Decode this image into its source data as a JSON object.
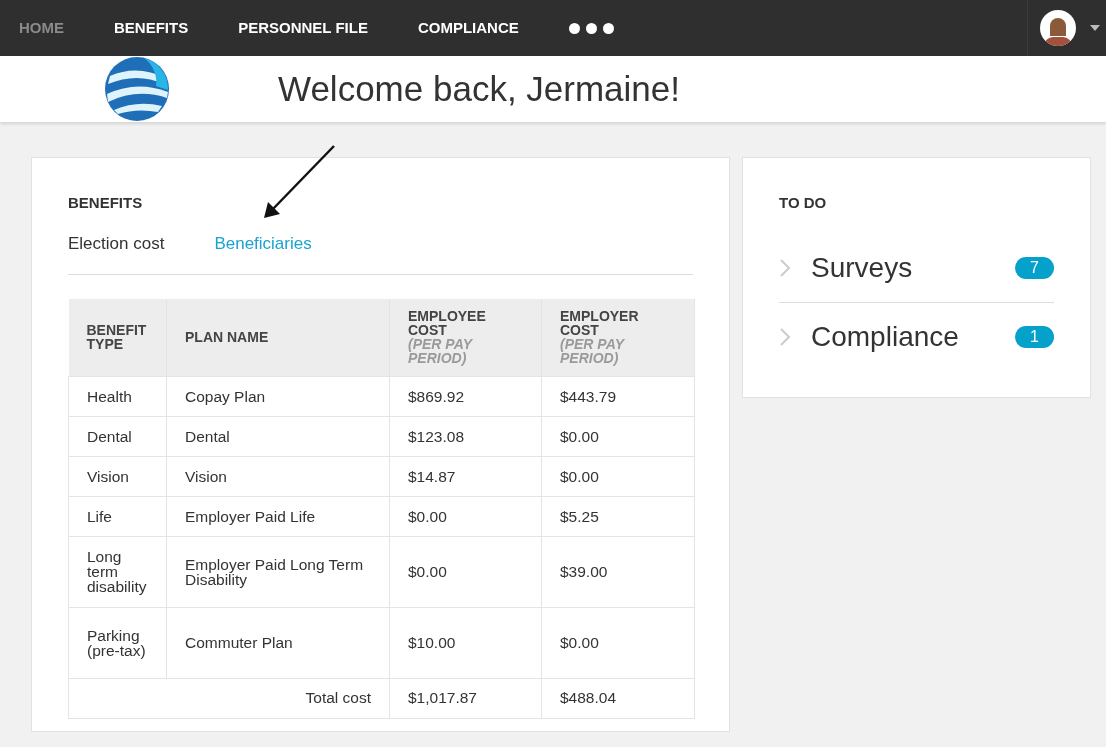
{
  "nav": {
    "items": [
      {
        "label": "HOME",
        "selected": true
      },
      {
        "label": "BENEFITS",
        "selected": false
      },
      {
        "label": "PERSONNEL FILE",
        "selected": false
      },
      {
        "label": "COMPLIANCE",
        "selected": false
      }
    ]
  },
  "header": {
    "title": "Welcome back, Jermaine!"
  },
  "benefits": {
    "heading": "BENEFITS",
    "tabs": [
      {
        "label": "Election cost",
        "selected": true
      },
      {
        "label": "Beneficiaries",
        "selected": false
      }
    ],
    "table": {
      "columns": [
        {
          "title": "BENEFIT TYPE"
        },
        {
          "title": "PLAN NAME"
        },
        {
          "title": "EMPLOYEE COST",
          "note": "(PER PAY PERIOD)"
        },
        {
          "title": "EMPLOYER COST",
          "note": "(PER PAY PERIOD)"
        }
      ],
      "rows": [
        [
          "Health",
          "Copay Plan",
          "$869.92",
          "$443.79"
        ],
        [
          "Dental",
          "Dental",
          "$123.08",
          "$0.00"
        ],
        [
          "Vision",
          "Vision",
          "$14.87",
          "$0.00"
        ],
        [
          "Life",
          "Employer Paid Life",
          "$0.00",
          "$5.25"
        ],
        [
          "Long term disability",
          "Employer Paid Long Term Disability",
          "$0.00",
          "$39.00"
        ],
        [
          "Parking (pre-tax)",
          "Commuter Plan",
          "$10.00",
          "$0.00"
        ]
      ],
      "total": {
        "label": "Total cost",
        "employee": "$1,017.87",
        "employer": "$488.04"
      }
    }
  },
  "todo": {
    "heading": "TO DO",
    "items": [
      {
        "label": "Surveys",
        "count": "7"
      },
      {
        "label": "Compliance",
        "count": "1"
      }
    ]
  }
}
